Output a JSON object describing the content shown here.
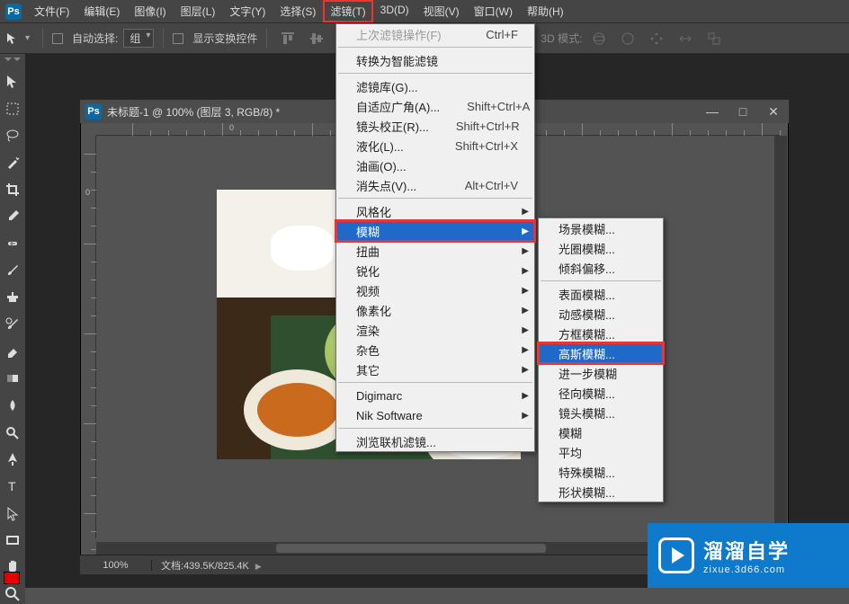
{
  "menubar": {
    "items": [
      "文件(F)",
      "编辑(E)",
      "图像(I)",
      "图层(L)",
      "文字(Y)",
      "选择(S)",
      "滤镜(T)",
      "3D(D)",
      "视图(V)",
      "窗口(W)",
      "帮助(H)"
    ],
    "highlighted_index": 6
  },
  "optionsbar": {
    "auto_select_label": "自动选择:",
    "auto_select_value": "组",
    "transform_label": "显示变换控件",
    "mode3d_label": "3D 模式:"
  },
  "document": {
    "title": "未标题-1 @ 100% (图层 3, RGB/8) *",
    "zoom": "100%",
    "status_label": "文档:",
    "status_value": "439.5K/825.4K",
    "ruler_h_labels": [
      "0"
    ],
    "ruler_v_labels": [
      "0"
    ]
  },
  "filter_menu": {
    "last": {
      "label": "上次滤镜操作(F)",
      "shortcut": "Ctrl+F",
      "dim": true
    },
    "smart": {
      "label": "转换为智能滤镜"
    },
    "items1": [
      {
        "label": "滤镜库(G)..."
      },
      {
        "label": "自适应广角(A)...",
        "shortcut": "Shift+Ctrl+A"
      },
      {
        "label": "镜头校正(R)...",
        "shortcut": "Shift+Ctrl+R"
      },
      {
        "label": "液化(L)...",
        "shortcut": "Shift+Ctrl+X"
      },
      {
        "label": "油画(O)..."
      },
      {
        "label": "消失点(V)...",
        "shortcut": "Alt+Ctrl+V"
      }
    ],
    "items2": [
      {
        "label": "风格化",
        "sub": true
      },
      {
        "label": "模糊",
        "sub": true,
        "hover": true,
        "redbox": true
      },
      {
        "label": "扭曲",
        "sub": true
      },
      {
        "label": "锐化",
        "sub": true
      },
      {
        "label": "视频",
        "sub": true
      },
      {
        "label": "像素化",
        "sub": true
      },
      {
        "label": "渲染",
        "sub": true
      },
      {
        "label": "杂色",
        "sub": true
      },
      {
        "label": "其它",
        "sub": true
      }
    ],
    "items3": [
      {
        "label": "Digimarc",
        "sub": true
      },
      {
        "label": "Nik Software",
        "sub": true
      }
    ],
    "browse": {
      "label": "浏览联机滤镜..."
    }
  },
  "blur_menu": {
    "g1": [
      "场景模糊...",
      "光圈模糊...",
      "倾斜偏移..."
    ],
    "g2": [
      {
        "label": "表面模糊..."
      },
      {
        "label": "动感模糊..."
      },
      {
        "label": "方框模糊..."
      },
      {
        "label": "高斯模糊...",
        "hover": true,
        "redbox": true
      },
      {
        "label": "进一步模糊"
      },
      {
        "label": "径向模糊..."
      },
      {
        "label": "镜头模糊..."
      },
      {
        "label": "模糊"
      },
      {
        "label": "平均"
      },
      {
        "label": "特殊模糊..."
      },
      {
        "label": "形状模糊..."
      }
    ]
  },
  "watermark": {
    "title": "溜溜自学",
    "sub": "zixue.3d66.com"
  }
}
